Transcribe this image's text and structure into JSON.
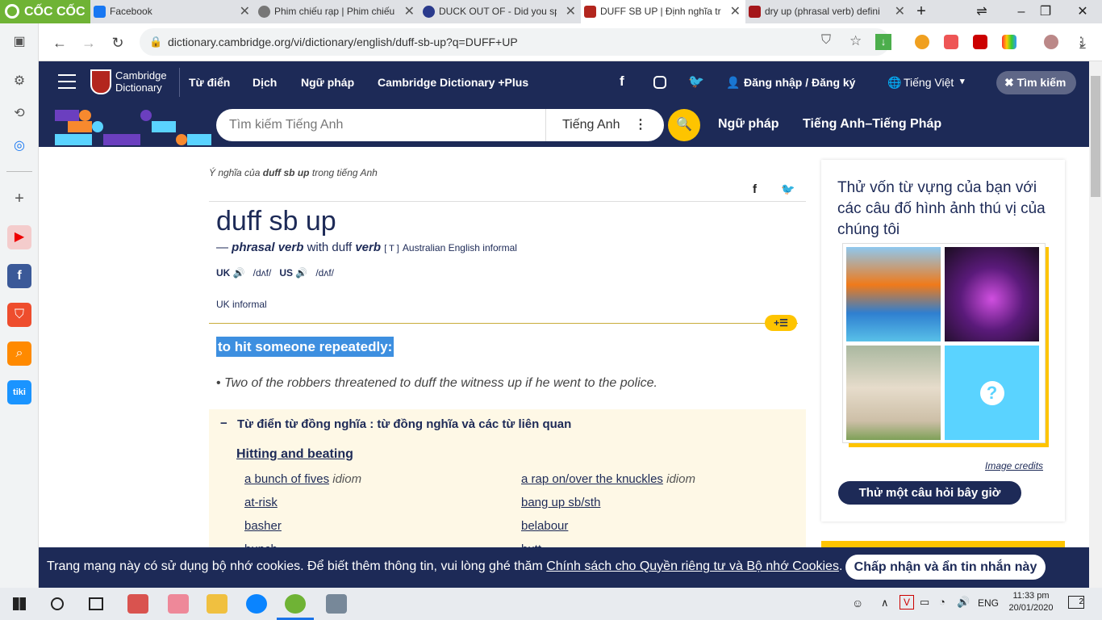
{
  "browser": {
    "brand": "CỐC CỐC",
    "tabs": [
      {
        "title": "Facebook",
        "color": "#1877f2",
        "active": false
      },
      {
        "title": "Phim chiếu rạp | Phim chiếu",
        "color": "#555555",
        "active": false
      },
      {
        "title": "DUCK OUT OF - Did you sp",
        "color": "#2a3a8c",
        "active": false
      },
      {
        "title": "DUFF SB UP | Định nghĩa tr",
        "color": "#b3261e",
        "active": true
      },
      {
        "title": "dry up (phrasal verb) defini",
        "color": "#a4161a",
        "active": false
      }
    ],
    "new_tab": "+",
    "url": "dictionary.cambridge.org/vi/dictionary/english/duff-sb-up?q=DUFF+UP"
  },
  "header": {
    "logo_line1": "Cambridge",
    "logo_line2": "Dictionary",
    "nav": [
      "Từ điển",
      "Dịch",
      "Ngữ pháp",
      "Cambridge Dictionary +Plus"
    ],
    "login": "Đăng nhập / Đăng ký",
    "language": "Tiếng Việt",
    "search_button": "Tìm kiếm",
    "search_placeholder": "Tìm kiếm Tiếng Anh",
    "search_lang": "Tiếng Anh",
    "links2": [
      "Ngữ pháp",
      "Tiếng Anh–Tiếng Pháp"
    ]
  },
  "entry": {
    "meaning_prefix": "Ý nghĩa của",
    "meaning_word": "duff sb up",
    "meaning_suffix": "trong tiếng Anh",
    "headword": "duff sb up",
    "dash": "—",
    "pos1": "phrasal verb",
    "with": "with duff",
    "pos2": "verb",
    "gram": "[ T ]",
    "region": "Australian English informal",
    "uk": "UK",
    "uk_ipa": "/dʌf/",
    "us": "US",
    "us_ipa": "/dʌf/",
    "register": "UK informal",
    "definition": "to hit someone repeatedly:",
    "example": "Two of the robbers threatened to duff the witness up if he went to the police.",
    "thesaurus_title": "Từ điển từ đồng nghĩa : từ đồng nghĩa và các từ liên quan",
    "thesaurus_heading": "Hitting and beating",
    "idiom": "idiom",
    "synonyms_left": [
      {
        "text": "a bunch of fives",
        "idiom": true
      },
      {
        "text": "at-risk",
        "idiom": false
      },
      {
        "text": "basher",
        "idiom": false
      },
      {
        "text": "bunch",
        "idiom": false
      }
    ],
    "synonyms_right": [
      {
        "text": "a rap on/over the knuckles",
        "idiom": true
      },
      {
        "text": "bang up sb/sth",
        "idiom": false
      },
      {
        "text": "belabour",
        "idiom": false
      },
      {
        "text": "butt",
        "idiom": false
      }
    ]
  },
  "panel": {
    "title": "Thử vốn từ vựng của bạn với các câu đố hình ảnh thú vị của chúng tôi",
    "credits": "Image credits",
    "button": "Thử một câu hỏi bây giờ",
    "question_mark": "?"
  },
  "cookie": {
    "text": "Trang mạng này có sử dụng bộ nhớ cookies. Để biết thêm thông tin, vui lòng ghé thăm",
    "link": "Chính sách cho Quyền riêng tư và Bộ nhớ Cookies",
    "period": ".",
    "button": "Chấp nhận và ẩn tin nhắn này"
  },
  "taskbar": {
    "lang": "ENG",
    "time": "11:33 pm",
    "date": "20/01/2020",
    "notifications": "2"
  },
  "colors": {
    "navy": "#1d2a57",
    "yellow": "#fec400",
    "highlight": "#3d8fe0",
    "thesaurus_bg": "#fef8e6"
  }
}
